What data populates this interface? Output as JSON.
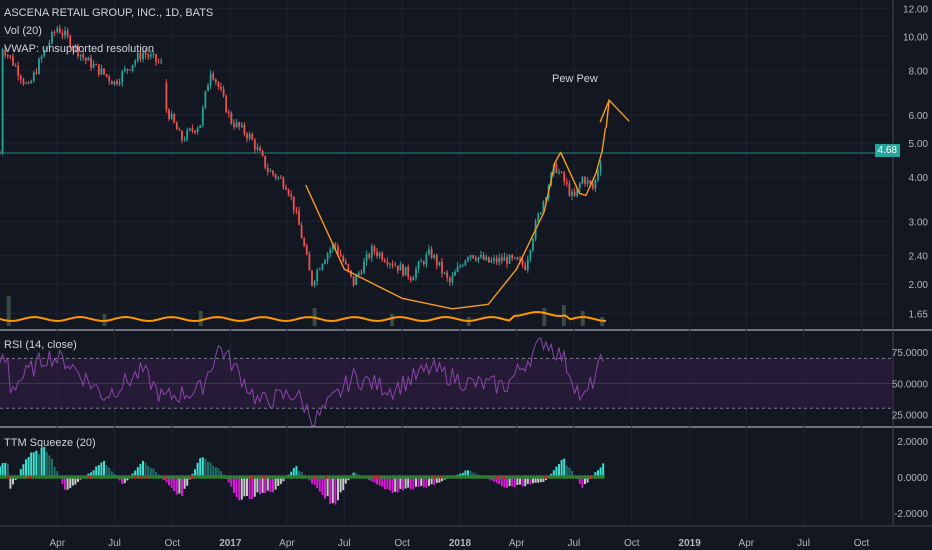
{
  "legend": {
    "symbol": "ASCENA RETAIL GROUP, INC., 1D, BATS",
    "volume": "Vol (20)",
    "vwap": "VWAP: unsupported resolution",
    "rsi": "RSI (14, close)",
    "ttm": "TTM Squeeze (20)"
  },
  "annotation": {
    "text": "Pew Pew"
  },
  "current_price": {
    "label": "4.68",
    "value": 4.68
  },
  "colors": {
    "background": "#131722",
    "up": "#26a69a",
    "down": "#ef5350",
    "cup_curve": "#f59b22",
    "rsi_line": "#8e44ad",
    "rsi_band": "#2a1d3c",
    "squeeze_pos": "#40e0d0",
    "squeeze_neg": "#d81bd8",
    "squeeze_dot": "#2e7d32",
    "volume_ma": "#ff9800",
    "price_line": "#26a69a"
  },
  "chart_data": [
    {
      "type": "line",
      "name": "price",
      "title": "ASCENA RETAIL GROUP, INC., 1D, BATS",
      "log_scale": true,
      "ylim": [
        1.5,
        12.5
      ],
      "ytick_labels": [
        "12.00",
        "10.00",
        "8.00",
        "6.00",
        "5.00",
        "4.00",
        "3.00",
        "2.40",
        "2.00",
        "1.65"
      ],
      "ytick_values": [
        12,
        10,
        8,
        6,
        5,
        4,
        3,
        2.4,
        2,
        1.65
      ],
      "x_labels": [
        "Apr",
        "Jul",
        "Oct",
        "2017",
        "Apr",
        "Jul",
        "Oct",
        "2018",
        "Apr",
        "Jul",
        "Oct",
        "2019",
        "Apr",
        "Jul",
        "Oct"
      ],
      "x": [
        "2016-01-04",
        "2016-02-15",
        "2016-04-01",
        "2016-05-15",
        "2016-07-01",
        "2016-08-15",
        "2016-09-15",
        "2016-09-20",
        "2016-10-15",
        "2016-11-15",
        "2016-12-01",
        "2017-01-01",
        "2017-02-01",
        "2017-03-01",
        "2017-04-01",
        "2017-05-10",
        "2017-05-25",
        "2017-06-15",
        "2017-07-15",
        "2017-08-15",
        "2017-09-15",
        "2017-10-15",
        "2017-11-15",
        "2017-12-15",
        "2018-01-15",
        "2018-02-15",
        "2018-03-15",
        "2018-04-15",
        "2018-05-15",
        "2018-06-01",
        "2018-06-15",
        "2018-07-01",
        "2018-07-15",
        "2018-08-01",
        "2018-08-15"
      ],
      "values": [
        9.4,
        7.1,
        10.6,
        8.6,
        7.4,
        9.0,
        8.3,
        6.3,
        5.1,
        5.7,
        8.1,
        5.8,
        5.2,
        4.2,
        3.8,
        2.0,
        2.3,
        2.6,
        2.0,
        2.5,
        2.3,
        2.1,
        2.45,
        2.0,
        2.45,
        2.3,
        2.35,
        2.25,
        3.5,
        4.3,
        3.9,
        3.45,
        4.0,
        3.7,
        4.68
      ],
      "annotations": [
        "Pew Pew"
      ]
    },
    {
      "type": "bar",
      "name": "Vol (20)",
      "note": "relative volume with moving average",
      "x": [
        "2016-01",
        "2016-06",
        "2016-11",
        "2017-05",
        "2017-09",
        "2018-01",
        "2018-05",
        "2018-06",
        "2018-07",
        "2018-08"
      ],
      "values": [
        1.0,
        0.4,
        0.5,
        0.6,
        0.4,
        0.3,
        0.6,
        0.7,
        0.5,
        0.3
      ]
    },
    {
      "type": "line",
      "name": "RSI (14, close)",
      "ylim": [
        15,
        92
      ],
      "ytick_labels": [
        "75.0000",
        "50.0000",
        "25.0000"
      ],
      "ytick_values": [
        75,
        50,
        25
      ],
      "bands": [
        30,
        70
      ],
      "x": [
        "2016-01",
        "2016-03",
        "2016-04",
        "2016-06",
        "2016-08",
        "2016-09",
        "2016-11",
        "2016-12",
        "2017-02",
        "2017-04",
        "2017-05",
        "2017-07",
        "2017-09",
        "2017-11",
        "2018-01",
        "2018-03",
        "2018-05",
        "2018-06",
        "2018-07",
        "2018-08"
      ],
      "values": [
        45,
        72,
        68,
        40,
        60,
        38,
        45,
        80,
        35,
        42,
        20,
        55,
        45,
        62,
        50,
        48,
        85,
        70,
        35,
        68
      ]
    },
    {
      "type": "bar",
      "name": "TTM Squeeze (20)",
      "ylim": [
        -2.4,
        2.4
      ],
      "ytick_labels": [
        "2.0000",
        "0.0000",
        "-2.0000"
      ],
      "ytick_values": [
        2,
        0,
        -2
      ],
      "x": [
        "2016-01",
        "2016-02",
        "2016-03",
        "2016-04",
        "2016-06",
        "2016-07",
        "2016-08",
        "2016-10",
        "2016-11",
        "2016-12",
        "2017-01",
        "2017-03",
        "2017-04",
        "2017-06",
        "2017-07",
        "2017-09",
        "2017-11",
        "2018-01",
        "2018-03",
        "2018-05",
        "2018-06",
        "2018-07",
        "2018-08"
      ],
      "values": [
        -0.9,
        1.2,
        1.6,
        -0.8,
        0.9,
        -0.5,
        1.0,
        -1.1,
        1.1,
        0.5,
        -1.3,
        -0.7,
        0.6,
        -1.6,
        0.3,
        -0.8,
        -0.5,
        0.4,
        -0.6,
        -0.3,
        1.0,
        -0.6,
        0.7
      ]
    }
  ]
}
